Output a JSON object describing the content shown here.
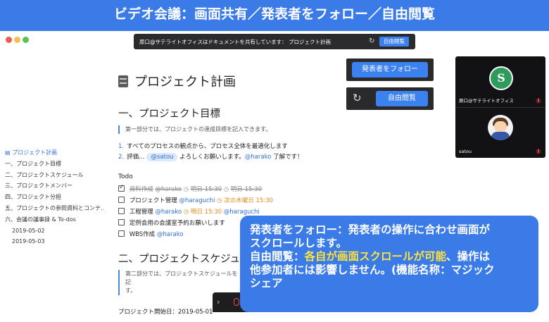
{
  "banner": {
    "title": "ビデオ会議：画面共有／発表者をフォロー／自由閲覧"
  },
  "share_bar": {
    "text": "原口@サテライトオフィスはドキュメントを共有しています： プロジェクト計画",
    "button": "自由閲覧"
  },
  "toc": {
    "items": [
      {
        "label": "プロジェクト計画",
        "active": true
      },
      {
        "label": "一、プロジェクト目標"
      },
      {
        "label": "二、プロジェクトスケジュール"
      },
      {
        "label": "三、プロジェクトメンバー"
      },
      {
        "label": "四、プロジェクト分担"
      },
      {
        "label": "五、プロジェクトの参照資料とコンテ…"
      },
      {
        "label": "六、会議の議事録 & To-dos"
      },
      {
        "label": "2019-05-02",
        "sub": true
      },
      {
        "label": "2019-05-03",
        "sub": true
      }
    ]
  },
  "doc": {
    "title": "プロジェクト計画",
    "section1": {
      "heading": "一、プロジェクト目標",
      "quote": "第一部分では、プロジェクトの達成目標を記入できます。",
      "list": [
        {
          "num": "1.",
          "text": "すべてのプロセスの観点から、プロセス全体を最適化します"
        },
        {
          "num": "2.",
          "pre": "評価…",
          "mention1": "@satou",
          "mid": "よろしくお願いします。",
          "mention2": "@harako",
          "post": "了解です！"
        }
      ]
    },
    "todo": {
      "heading": "Todo",
      "items": [
        {
          "checked": true,
          "task": "資料作成",
          "mention": "@harako",
          "date1": "明日 15:30",
          "date2": "明日 15:30"
        },
        {
          "checked": false,
          "task": "プロジェクト管理",
          "mention": "@haraguchi",
          "date": "次の木曜日 15:30"
        },
        {
          "checked": false,
          "task": "工程管理",
          "mention": "@harako",
          "date": "明日 15:30",
          "mention2": "@haraguchi"
        },
        {
          "checked": false,
          "task": "定例会用の会議室予約お願いします"
        },
        {
          "checked": false,
          "task": "WBS作成",
          "mention": "@harako"
        }
      ]
    },
    "section2": {
      "heading": "二、プロジェクトスケジュール",
      "quote": "第二部分では、プロジェクトスケジュールを記",
      "quote2": "す。",
      "start": "プロジェクト開始日：2019-05-01"
    }
  },
  "controls": {
    "follow_label": "発表者をフォロー",
    "free_label": "自由閲覧"
  },
  "video": {
    "tiles": [
      {
        "name": "原口@サテライトオフィス"
      },
      {
        "name": "satou"
      }
    ]
  },
  "callout": {
    "line1": "発表者をフォロー：発表者の操作に合わせ画面が",
    "line2": "スクロールします。",
    "line3_pre": "自由閲覧：",
    "line3_hl": "各自が画面スクロールが可能",
    "line3_post": "、操作は",
    "line4": "他参加者には影響しません。(機能名称：マジック",
    "line5": "シェア"
  },
  "colors": {
    "accent": "#3a7be8",
    "highlight": "#ffe23c",
    "dark": "#2a2a2d"
  }
}
